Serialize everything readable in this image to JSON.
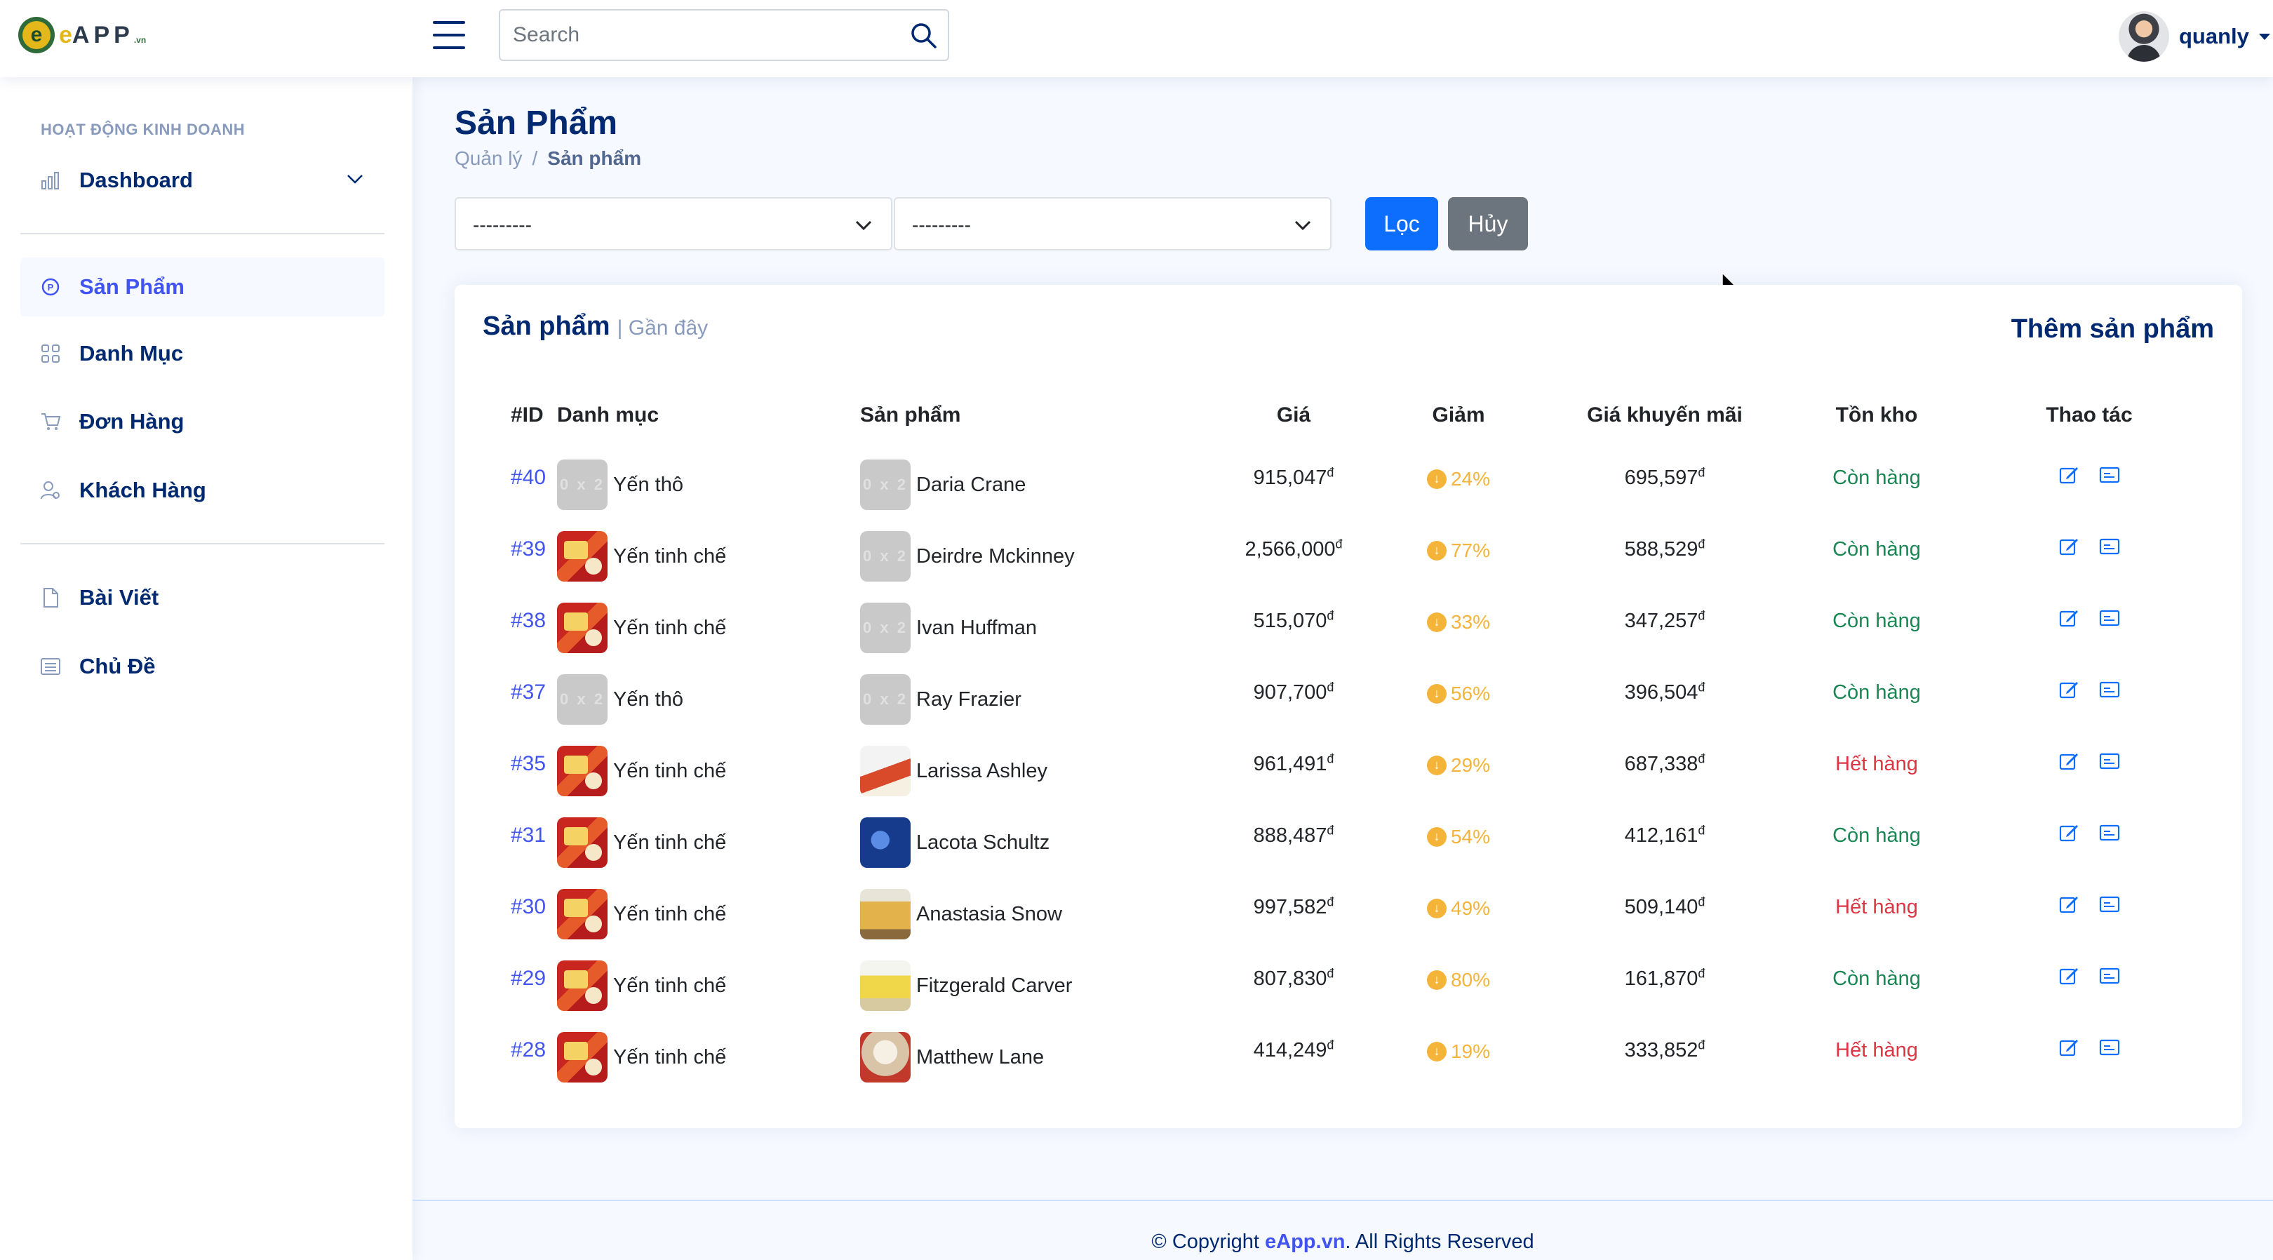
{
  "header": {
    "logo_text": "APP",
    "logo_sub": ".vn",
    "search_placeholder": "Search",
    "user_name": "quanly"
  },
  "sidebar": {
    "heading": "HOẠT ĐỘNG KINH DOANH",
    "items": [
      {
        "label": "Dashboard",
        "icon": "bar-chart-icon"
      },
      {
        "label": "Sản Phẩm",
        "icon": "product-icon",
        "active": true
      },
      {
        "label": "Danh Mục",
        "icon": "grid-icon"
      },
      {
        "label": "Đơn Hàng",
        "icon": "cart-icon"
      },
      {
        "label": "Khách Hàng",
        "icon": "person-icon"
      },
      {
        "label": "Bài Viết",
        "icon": "file-icon"
      },
      {
        "label": "Chủ Đề",
        "icon": "list-icon"
      }
    ]
  },
  "page": {
    "title": "Sản Phẩm",
    "breadcrumb": [
      "Quản lý",
      "/",
      "Sản phẩm"
    ]
  },
  "filters": {
    "select1": "---------",
    "select2": "---------",
    "filter_button": "Lọc",
    "cancel_button": "Hủy"
  },
  "card": {
    "title": "Sản phẩm",
    "subtitle": "| Gần đây",
    "add_link": "Thêm sản phẩm"
  },
  "table": {
    "columns": [
      "#ID",
      "Danh mục",
      "Sản phẩm",
      "Giá",
      "Giảm",
      "Giá khuyến mãi",
      "Tồn kho",
      "Thao tác"
    ],
    "currency": "đ",
    "placeholder_thumb": "0 x 2",
    "rows": [
      {
        "id": "#40",
        "category": "Yến thô",
        "product": "Daria Crane",
        "price": "915,047",
        "discount": "24%",
        "promo": "695,597",
        "stock": "Còn hàng"
      },
      {
        "id": "#39",
        "category": "Yến tinh chế",
        "product": "Deirdre Mckinney",
        "price": "2,566,000",
        "discount": "77%",
        "promo": "588,529",
        "stock": "Còn hàng"
      },
      {
        "id": "#38",
        "category": "Yến tinh chế",
        "product": "Ivan Huffman",
        "price": "515,070",
        "discount": "33%",
        "promo": "347,257",
        "stock": "Còn hàng"
      },
      {
        "id": "#37",
        "category": "Yến thô",
        "product": "Ray Frazier",
        "price": "907,700",
        "discount": "56%",
        "promo": "396,504",
        "stock": "Còn hàng"
      },
      {
        "id": "#35",
        "category": "Yến tinh chế",
        "product": "Larissa Ashley",
        "price": "961,491",
        "discount": "29%",
        "promo": "687,338",
        "stock": "Hết hàng"
      },
      {
        "id": "#31",
        "category": "Yến tinh chế",
        "product": "Lacota Schultz",
        "price": "888,487",
        "discount": "54%",
        "promo": "412,161",
        "stock": "Còn hàng"
      },
      {
        "id": "#30",
        "category": "Yến tinh chế",
        "product": "Anastasia Snow",
        "price": "997,582",
        "discount": "49%",
        "promo": "509,140",
        "stock": "Hết hàng"
      },
      {
        "id": "#29",
        "category": "Yến tinh chế",
        "product": "Fitzgerald Carver",
        "price": "807,830",
        "discount": "80%",
        "promo": "161,870",
        "stock": "Còn hàng"
      },
      {
        "id": "#28",
        "category": "Yến tinh chế",
        "product": "Matthew Lane",
        "price": "414,249",
        "discount": "19%",
        "promo": "333,852",
        "stock": "Hết hàng"
      }
    ]
  },
  "footer": {
    "prefix": "© Copyright ",
    "brand": "eApp.vn",
    "suffix": ". All Rights Reserved"
  },
  "colors": {
    "primary": "#4154f1",
    "navy": "#012970",
    "in_stock": "#198754",
    "out_of_stock": "#dc3545",
    "discount": "#f4b43a",
    "button_primary": "#0d6efd",
    "button_secondary": "#6c757d"
  }
}
